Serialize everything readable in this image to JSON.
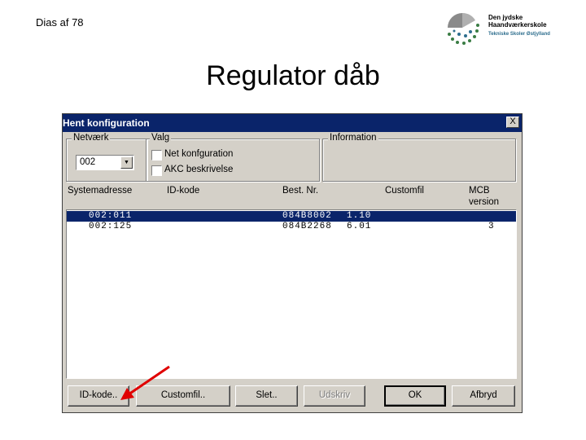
{
  "slide": {
    "number_text": "Dias af 78",
    "title": "Regulator dåb"
  },
  "logo": {
    "name_line1": "Den jydske",
    "name_line2": "Haandværkerskole",
    "subtitle": "Tekniske Skoler Østjylland"
  },
  "dialog": {
    "title": "Hent konfiguration",
    "close_label": "X",
    "network": {
      "legend": "Netværk",
      "selected": "002"
    },
    "options": {
      "legend": "Valg",
      "net_config": {
        "label": "Net konfguration",
        "checked": false
      },
      "akc_desc": {
        "label": "AKC beskrivelse",
        "checked": false
      }
    },
    "information": {
      "legend": "Information"
    },
    "columns": {
      "address": "Systemadresse",
      "id": "ID-kode",
      "order": "Best. Nr.",
      "customfile": "Customfil",
      "mcb_line1": "MCB",
      "mcb_line2": "version"
    },
    "rows": [
      {
        "address": "002:011",
        "id": "",
        "order": "084B8002",
        "customfile": "1.10",
        "mcb": "",
        "selected": true
      },
      {
        "address": "002:125",
        "id": "",
        "order": "084B2268",
        "customfile": "6.01",
        "mcb": "3",
        "selected": false
      }
    ],
    "buttons": {
      "id_code": "ID-kode..",
      "customfile": "Customfil..",
      "delete": "Slet..",
      "print": "Udskriv",
      "ok": "OK",
      "cancel": "Afbryd"
    }
  },
  "colors": {
    "titlebar": "#0a246a",
    "dialog_bg": "#d4d0c8",
    "selection": "#0a246a",
    "annotation_arrow": "#e00000"
  }
}
